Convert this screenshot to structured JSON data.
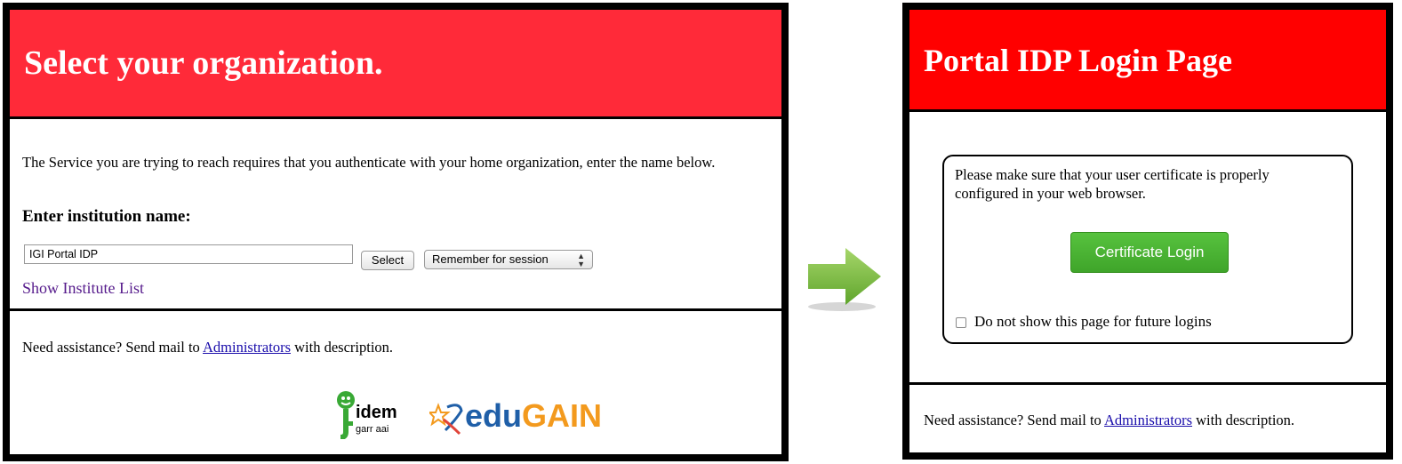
{
  "left_panel": {
    "title": "Select your organization.",
    "intro": "The Service you are trying to reach requires that you authenticate with your home organization, enter the name below.",
    "institution_label": "Enter institution name:",
    "institution_input_value": "IGI Portal IDP",
    "select_button": "Select",
    "remember_select_value": "Remember for session",
    "show_list_link": "Show Institute List",
    "assist_prefix": "Need assistance? Send mail to ",
    "assist_link": "Administrators",
    "assist_suffix": " with description.",
    "idem_logo_text": "idem",
    "idem_logo_subtext": "garr aai",
    "edugain_logo_part1": "edu",
    "edugain_logo_part2": "GAIN"
  },
  "right_panel": {
    "title": "Portal IDP Login Page",
    "cert_message": "Please make sure that your user certificate is properly configured in your web browser.",
    "cert_login_button": "Certificate Login",
    "no_show_label": "Do not show this page for future logins",
    "assist_prefix": "Need assistance? Send mail to ",
    "assist_link": "Administrators",
    "assist_suffix": " with description."
  },
  "colors": {
    "left_header": "#ff2a39",
    "right_header": "#ff0000",
    "login_button": "#4cb335",
    "arrow": "#7fc241",
    "link": "#1a0dab"
  },
  "icons": {
    "arrow": "right-arrow-icon",
    "select_arrows": "updown-chevron-icon"
  }
}
